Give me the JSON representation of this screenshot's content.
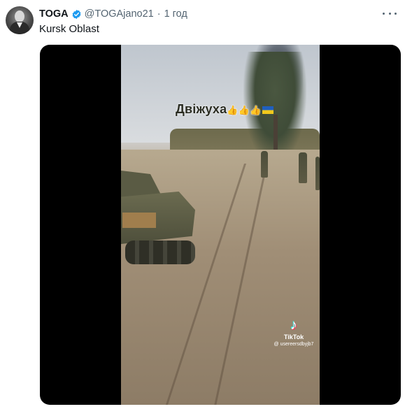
{
  "tweet": {
    "display_name": "TOGA",
    "handle": "@TOGAjano21",
    "separator": "·",
    "time": "1 год",
    "text": "Kursk Oblast",
    "icons": {
      "avatar": "profile-avatar",
      "verified": "verified-badge-icon",
      "more": "more-options-icon"
    },
    "colors": {
      "verified": "#1d9bf0",
      "secondary_text": "#536471",
      "primary_text": "#0f1419"
    }
  },
  "video": {
    "caption": "Двіжуха",
    "caption_emojis": "👍👍👍",
    "watermark": {
      "logo": "♪",
      "brand": "TikTok",
      "username": "@ usereersdbyjb7"
    }
  }
}
